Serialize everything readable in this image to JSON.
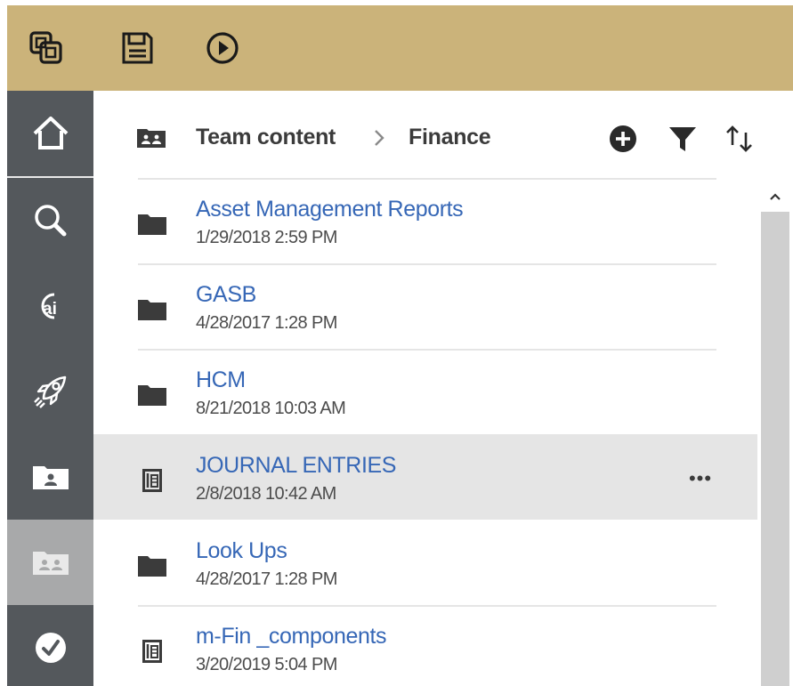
{
  "toolbar": {
    "icons": [
      "app-switcher-icon",
      "save-icon",
      "play-icon"
    ],
    "bg_color": "#cbb37a"
  },
  "sidebar": {
    "items": [
      {
        "icon": "home-icon"
      },
      {
        "icon": "search-icon"
      },
      {
        "icon": "ai-assistant-icon"
      },
      {
        "icon": "rocket-icon"
      },
      {
        "icon": "my-content-folder-icon"
      },
      {
        "icon": "team-content-folder-icon",
        "active": true
      },
      {
        "icon": "checkmark-icon"
      }
    ]
  },
  "breadcrumb": {
    "root": "Team content",
    "separator": ">",
    "current": "Finance"
  },
  "actions": [
    "add-icon",
    "filter-icon",
    "sort-icon"
  ],
  "items": [
    {
      "type": "folder",
      "name": "Asset Management Reports",
      "date": "1/29/2018 2:59 PM"
    },
    {
      "type": "folder",
      "name": "GASB",
      "date": "4/28/2017 1:28 PM"
    },
    {
      "type": "folder",
      "name": "HCM",
      "date": "8/21/2018 10:03 AM"
    },
    {
      "type": "package",
      "name": "JOURNAL ENTRIES",
      "date": "2/8/2018 10:42 AM",
      "highlighted": true,
      "more": "•••"
    },
    {
      "type": "folder",
      "name": "Look Ups",
      "date": "4/28/2017 1:28 PM"
    },
    {
      "type": "package",
      "name": "m-Fin _components",
      "date": "3/20/2019 5:04 PM"
    }
  ],
  "colors": {
    "link": "#3667b6",
    "sidebar": "#54585c",
    "sidebar_active": "#a8a9aa",
    "row_highlight": "#e5e5e5"
  }
}
